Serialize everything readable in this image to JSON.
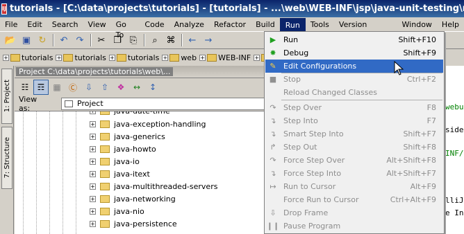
{
  "window": {
    "title": "tutorials - [C:\\data\\projects\\tutorials] - [tutorials] - ...\\web\\WEB-INF\\jsp\\java-unit-testing\\running-tests-"
  },
  "menubar": [
    "File",
    "Edit",
    "Search",
    "View",
    "Go To",
    "Code",
    "Analyze",
    "Refactor",
    "Build",
    "Run",
    "Tools",
    "Version Control",
    "Window",
    "Help"
  ],
  "breadcrumbs": [
    "tutorials",
    "tutorials",
    "tutorials",
    "web",
    "WEB-INF",
    "js"
  ],
  "tool_tabs": {
    "project": "1: Project",
    "structure": "7: Structure"
  },
  "project_panel": {
    "header": "Project  C:\\data\\projects\\tutorials\\web\\...",
    "view_as_label": "View as:",
    "view_as_value": "Project",
    "tree_items": [
      "java-date-time",
      "java-exception-handling",
      "java-generics",
      "java-howto",
      "java-io",
      "java-itext",
      "java-multithreaded-servers",
      "java-networking",
      "java-nio",
      "java-persistence"
    ]
  },
  "run_menu": {
    "items": [
      {
        "label": "Run",
        "shortcut": "Shift+F10",
        "enabled": true,
        "icon": "run-icon"
      },
      {
        "label": "Debug",
        "shortcut": "Shift+F9",
        "enabled": true,
        "icon": "debug-icon"
      },
      {
        "label": "Edit Configurations",
        "shortcut": "",
        "enabled": true,
        "highlighted": true,
        "icon": "edit-configurations-icon"
      },
      {
        "label": "Stop",
        "shortcut": "Ctrl+F2",
        "enabled": false,
        "icon": "stop-icon"
      },
      {
        "label": "Reload Changed Classes",
        "shortcut": "",
        "enabled": false,
        "icon": ""
      },
      {
        "label": "Step Over",
        "shortcut": "F8",
        "enabled": false,
        "icon": "step-over-icon"
      },
      {
        "label": "Step Into",
        "shortcut": "F7",
        "enabled": false,
        "icon": "step-into-icon"
      },
      {
        "label": "Smart Step Into",
        "shortcut": "Shift+F7",
        "enabled": false,
        "icon": "smart-step-into-icon"
      },
      {
        "label": "Step Out",
        "shortcut": "Shift+F8",
        "enabled": false,
        "icon": "step-out-icon"
      },
      {
        "label": "Force Step Over",
        "shortcut": "Alt+Shift+F8",
        "enabled": false,
        "icon": "force-step-over-icon"
      },
      {
        "label": "Force Step Into",
        "shortcut": "Alt+Shift+F7",
        "enabled": false,
        "icon": "force-step-into-icon"
      },
      {
        "label": "Run to Cursor",
        "shortcut": "Alt+F9",
        "enabled": false,
        "icon": "run-to-cursor-icon"
      },
      {
        "label": "Force Run to Cursor",
        "shortcut": "Ctrl+Alt+F9",
        "enabled": false,
        "icon": ""
      },
      {
        "label": "Drop Frame",
        "shortcut": "",
        "enabled": false,
        "icon": "drop-frame-icon"
      },
      {
        "label": "Pause Program",
        "shortcut": "",
        "enabled": false,
        "icon": "pause-icon"
      }
    ]
  },
  "editor_snippets": [
    "webu",
    "side",
    "INF/j",
    "lliJ",
    "e Int"
  ],
  "colors": {
    "titlebar": "#0a246a",
    "menu_highlight": "#316ac5",
    "editor_green": "#008000"
  }
}
